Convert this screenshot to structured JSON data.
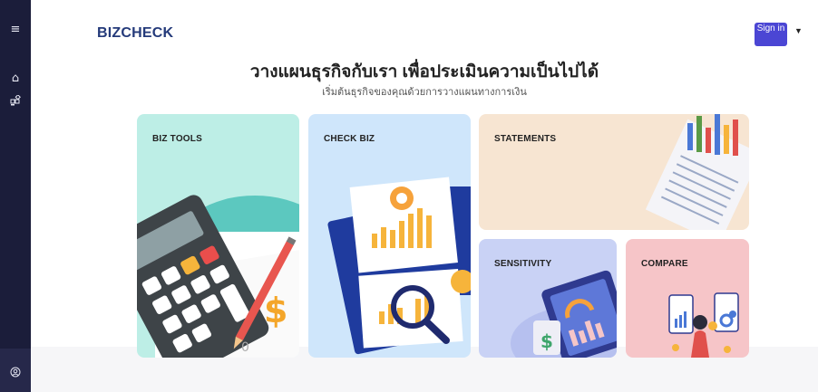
{
  "sidebar": {
    "menu_icon": "menu-icon",
    "home_icon": "home-icon",
    "apps_icon": "apps-icon",
    "profile_icon": "user-circle-icon"
  },
  "header": {
    "logo": "BIZCHECK",
    "signin_label": "Sign in",
    "dropdown_icon": "caret-down-icon"
  },
  "hero": {
    "title": "วางแผนธุรกิจกับเรา เพื่อประเมินความเป็นไปได้",
    "subtitle": "เริ่มต้นธุรกิจของคุณด้วยการวางแผนทางการเงิน"
  },
  "cards": {
    "biz_tools": "BIZ TOOLS",
    "check_biz": "CHECK BIZ",
    "statements": "STATEMENTS",
    "sensitivity": "SENSITIVITY",
    "compare": "COMPARE"
  },
  "colors": {
    "sidebar": "#1b1d3a",
    "accent": "#4b46d4",
    "biz_tools_bg": "#bdeee6",
    "check_biz_bg": "#cfe6fb",
    "statements_bg": "#f7e5d2",
    "sensitivity_bg": "#c9d2f5",
    "compare_bg": "#f6c5c8"
  }
}
